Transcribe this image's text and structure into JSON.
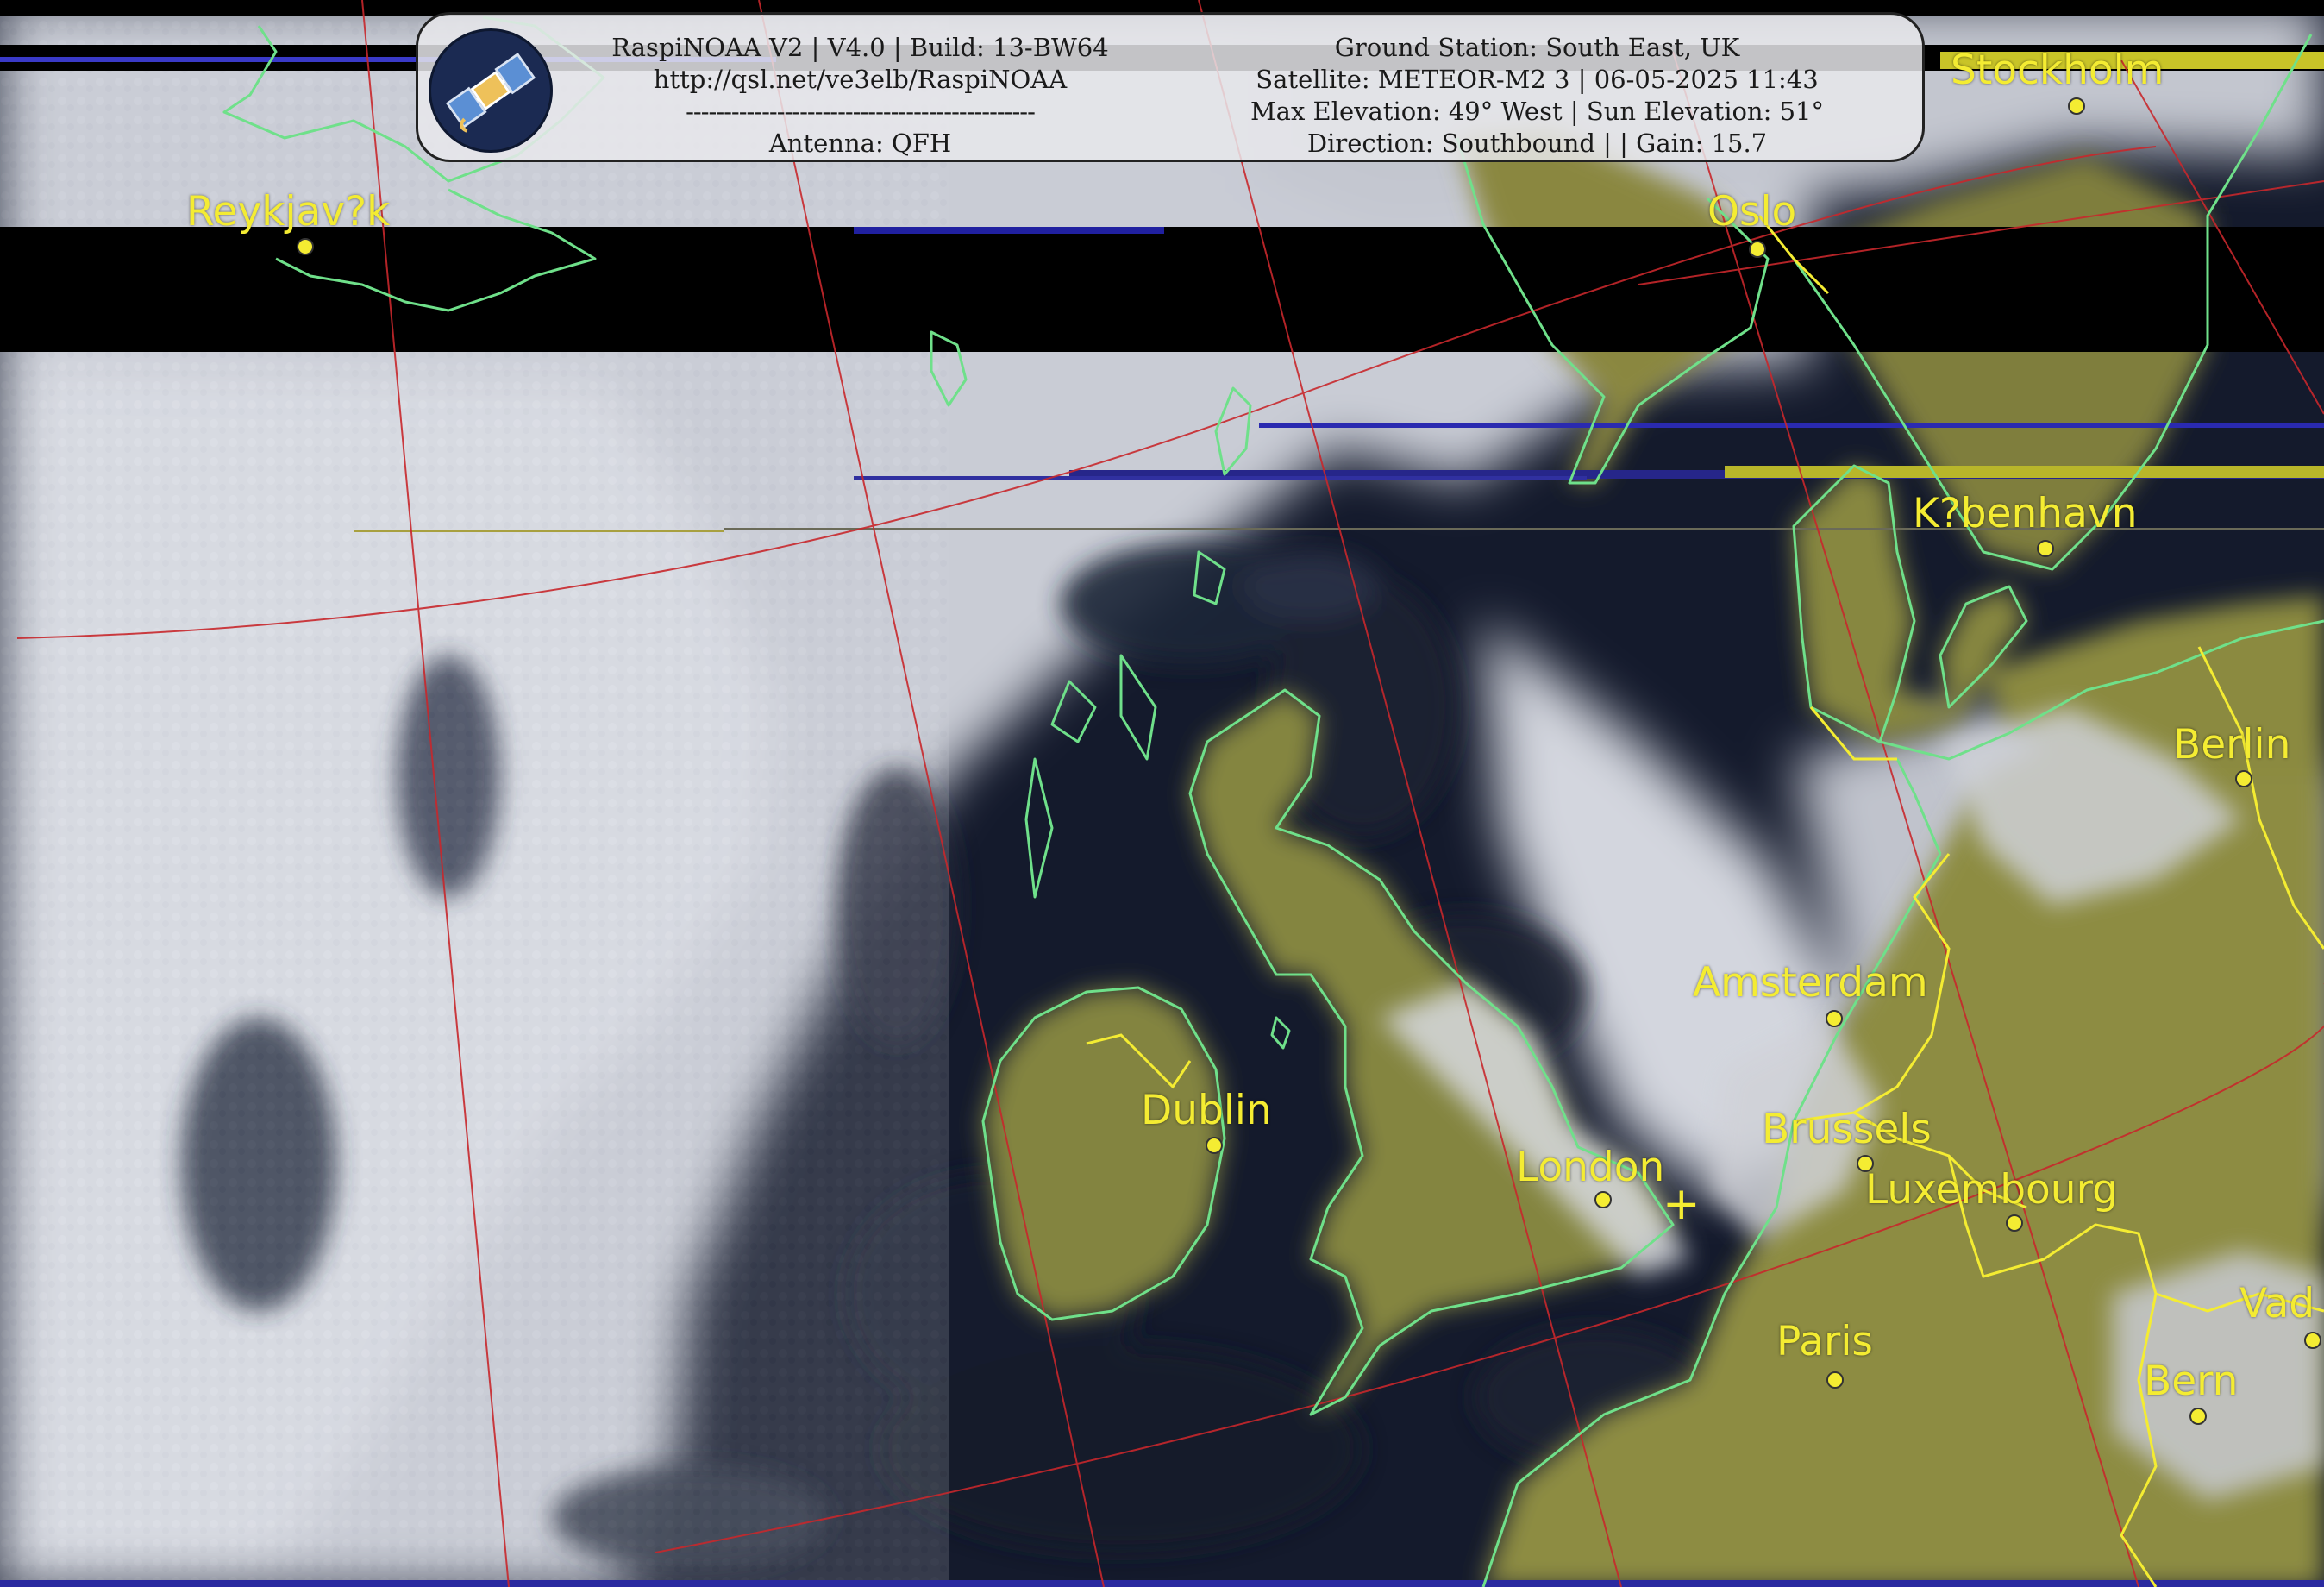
{
  "header": {
    "left_line1": "RaspiNOAA V2 | V4.0 | Build: 13-BW64",
    "left_line2": "http://qsl.net/ve3elb/RaspiNOAA",
    "left_line3": "----------------------------------------------",
    "left_line4": "Antenna: QFH",
    "right_line1": "Ground Station: South East, UK",
    "right_line2": "Satellite: METEOR-M2 3 | 06-05-2025 11:43",
    "right_line3": "Max Elevation: 49° West | Sun Elevation: 51°",
    "right_line4": "Direction: Southbound | | Gain: 15.7",
    "logo_icon": "satellite-icon"
  },
  "cities": {
    "stockholm": "Stockholm",
    "reykjavik": "Reykjav?k",
    "oslo": "Oslo",
    "kobenhavn": "K?benhavn",
    "berlin": "Berlin",
    "amsterdam": "Amsterdam",
    "dublin": "Dublin",
    "brussels": "Brussels",
    "london": "London",
    "luxembourg": "Luxembourg",
    "paris": "Paris",
    "vaduz": "Vad",
    "bern": "Bern"
  },
  "ground_station_marker": "+",
  "colors": {
    "label": "#f4ec32",
    "coastline": "#6fe08a",
    "border": "#f4ec32",
    "grid": "#c8282c",
    "land": "#8a8a3c",
    "sea": "#141a2c",
    "cloud": "#d8dbe2",
    "dropout_band": "#000000"
  }
}
